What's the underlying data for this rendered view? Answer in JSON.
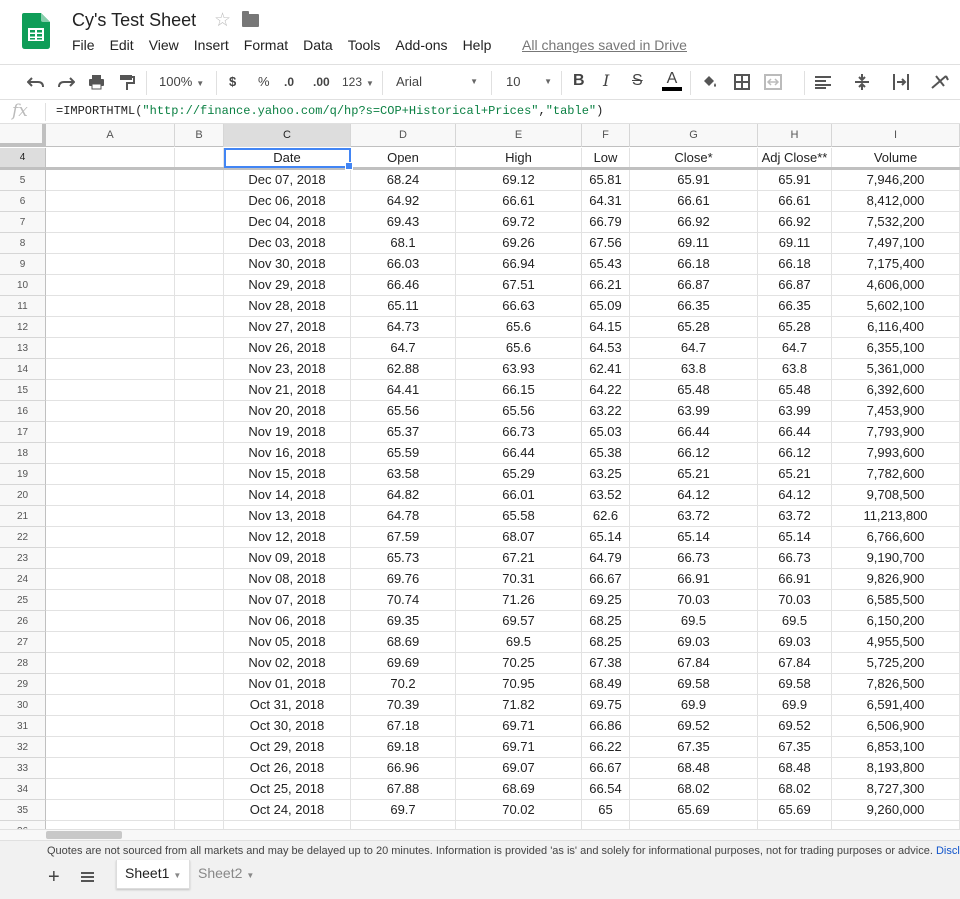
{
  "header": {
    "title": "Cy's Test Sheet",
    "menu": [
      "File",
      "Edit",
      "View",
      "Insert",
      "Format",
      "Data",
      "Tools",
      "Add-ons",
      "Help"
    ],
    "saved_status": "All changes saved in Drive"
  },
  "toolbar": {
    "zoom": "100%",
    "currency": "$",
    "percent": "%",
    "decrease_decimals": ".0",
    "increase_decimals": ".00",
    "more_formats": "123",
    "font": "Arial",
    "font_size": "10",
    "bold": "B",
    "italic": "I",
    "strikethrough": "S",
    "text_color_letter": "A"
  },
  "formula_bar": {
    "fx": "fx",
    "func": "=IMPORTHTML(",
    "url": "\"http://finance.yahoo.com/q/hp?s=COP+Historical+Prices\"",
    "comma": ",",
    "arg2": "\"table\"",
    "close": ")"
  },
  "columns": [
    "A",
    "B",
    "C",
    "D",
    "E",
    "F",
    "G",
    "H",
    "I"
  ],
  "selected_column": "C",
  "first_row_number": 4,
  "table": {
    "headers": [
      "Date",
      "Open",
      "High",
      "Low",
      "Close*",
      "Adj Close**",
      "Volume"
    ],
    "rows": [
      [
        "Dec 07, 2018",
        "68.24",
        "69.12",
        "65.81",
        "65.91",
        "65.91",
        "7,946,200"
      ],
      [
        "Dec 06, 2018",
        "64.92",
        "66.61",
        "64.31",
        "66.61",
        "66.61",
        "8,412,000"
      ],
      [
        "Dec 04, 2018",
        "69.43",
        "69.72",
        "66.79",
        "66.92",
        "66.92",
        "7,532,200"
      ],
      [
        "Dec 03, 2018",
        "68.1",
        "69.26",
        "67.56",
        "69.11",
        "69.11",
        "7,497,100"
      ],
      [
        "Nov 30, 2018",
        "66.03",
        "66.94",
        "65.43",
        "66.18",
        "66.18",
        "7,175,400"
      ],
      [
        "Nov 29, 2018",
        "66.46",
        "67.51",
        "66.21",
        "66.87",
        "66.87",
        "4,606,000"
      ],
      [
        "Nov 28, 2018",
        "65.11",
        "66.63",
        "65.09",
        "66.35",
        "66.35",
        "5,602,100"
      ],
      [
        "Nov 27, 2018",
        "64.73",
        "65.6",
        "64.15",
        "65.28",
        "65.28",
        "6,116,400"
      ],
      [
        "Nov 26, 2018",
        "64.7",
        "65.6",
        "64.53",
        "64.7",
        "64.7",
        "6,355,100"
      ],
      [
        "Nov 23, 2018",
        "62.88",
        "63.93",
        "62.41",
        "63.8",
        "63.8",
        "5,361,000"
      ],
      [
        "Nov 21, 2018",
        "64.41",
        "66.15",
        "64.22",
        "65.48",
        "65.48",
        "6,392,600"
      ],
      [
        "Nov 20, 2018",
        "65.56",
        "65.56",
        "63.22",
        "63.99",
        "63.99",
        "7,453,900"
      ],
      [
        "Nov 19, 2018",
        "65.37",
        "66.73",
        "65.03",
        "66.44",
        "66.44",
        "7,793,900"
      ],
      [
        "Nov 16, 2018",
        "65.59",
        "66.44",
        "65.38",
        "66.12",
        "66.12",
        "7,993,600"
      ],
      [
        "Nov 15, 2018",
        "63.58",
        "65.29",
        "63.25",
        "65.21",
        "65.21",
        "7,782,600"
      ],
      [
        "Nov 14, 2018",
        "64.82",
        "66.01",
        "63.52",
        "64.12",
        "64.12",
        "9,708,500"
      ],
      [
        "Nov 13, 2018",
        "64.78",
        "65.58",
        "62.6",
        "63.72",
        "63.72",
        "11,213,800"
      ],
      [
        "Nov 12, 2018",
        "67.59",
        "68.07",
        "65.14",
        "65.14",
        "65.14",
        "6,766,600"
      ],
      [
        "Nov 09, 2018",
        "65.73",
        "67.21",
        "64.79",
        "66.73",
        "66.73",
        "9,190,700"
      ],
      [
        "Nov 08, 2018",
        "69.76",
        "70.31",
        "66.67",
        "66.91",
        "66.91",
        "9,826,900"
      ],
      [
        "Nov 07, 2018",
        "70.74",
        "71.26",
        "69.25",
        "70.03",
        "70.03",
        "6,585,500"
      ],
      [
        "Nov 06, 2018",
        "69.35",
        "69.57",
        "68.25",
        "69.5",
        "69.5",
        "6,150,200"
      ],
      [
        "Nov 05, 2018",
        "68.69",
        "69.5",
        "68.25",
        "69.03",
        "69.03",
        "4,955,500"
      ],
      [
        "Nov 02, 2018",
        "69.69",
        "70.25",
        "67.38",
        "67.84",
        "67.84",
        "5,725,200"
      ],
      [
        "Nov 01, 2018",
        "70.2",
        "70.95",
        "68.49",
        "69.58",
        "69.58",
        "7,826,500"
      ],
      [
        "Oct 31, 2018",
        "70.39",
        "71.82",
        "69.75",
        "69.9",
        "69.9",
        "6,591,400"
      ],
      [
        "Oct 30, 2018",
        "67.18",
        "69.71",
        "66.86",
        "69.52",
        "69.52",
        "6,506,900"
      ],
      [
        "Oct 29, 2018",
        "69.18",
        "69.71",
        "66.22",
        "67.35",
        "67.35",
        "6,853,100"
      ],
      [
        "Oct 26, 2018",
        "66.96",
        "69.07",
        "66.67",
        "68.48",
        "68.48",
        "8,193,800"
      ],
      [
        "Oct 25, 2018",
        "67.88",
        "68.69",
        "66.54",
        "68.02",
        "68.02",
        "8,727,300"
      ],
      [
        "Oct 24, 2018",
        "69.7",
        "70.02",
        "65",
        "65.69",
        "65.69",
        "9,260,000"
      ]
    ]
  },
  "disclaimer": {
    "text": "Quotes are not sourced from all markets and may be delayed up to 20 minutes. Information is provided 'as is' and solely for informational purposes, not for trading purposes or advice.",
    "link": "Discl"
  },
  "sheets": [
    {
      "name": "Sheet1",
      "active": true
    },
    {
      "name": "Sheet2",
      "active": false
    }
  ],
  "colors": {
    "accent": "#4285f4",
    "sheets_green": "#0f9d58",
    "formula_string": "#0b8043",
    "link": "#1155cc"
  },
  "icons": [
    "sheets-logo-icon",
    "star-icon",
    "folder-icon",
    "undo-icon",
    "redo-icon",
    "print-icon",
    "paint-format-icon",
    "fill-color-icon",
    "borders-icon",
    "merge-cells-icon",
    "align-left-icon",
    "vertical-align-icon",
    "text-wrap-icon",
    "text-rotation-icon",
    "add-sheet-icon",
    "all-sheets-icon"
  ]
}
